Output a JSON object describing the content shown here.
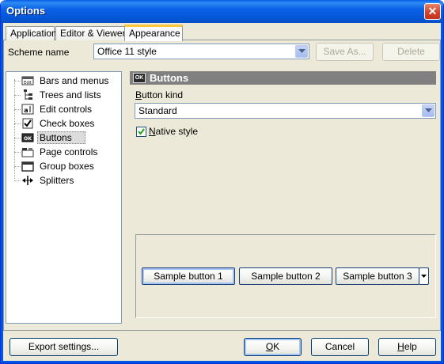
{
  "window": {
    "title": "Options"
  },
  "tabs": [
    {
      "label": "Application"
    },
    {
      "label": "Editor & Viewers"
    },
    {
      "label": "Appearance"
    }
  ],
  "scheme": {
    "label": "Scheme name",
    "value": "Office 11 style",
    "save_as": "Save As...",
    "delete": "Delete"
  },
  "tree": {
    "items": [
      {
        "label": "Bars and menus",
        "icon": "bars-menus-icon"
      },
      {
        "label": "Trees and lists",
        "icon": "tree-list-icon"
      },
      {
        "label": "Edit controls",
        "icon": "edit-control-icon"
      },
      {
        "label": "Check boxes",
        "icon": "checkbox-icon"
      },
      {
        "label": "Buttons",
        "icon": "button-icon"
      },
      {
        "label": "Page controls",
        "icon": "page-control-icon"
      },
      {
        "label": "Group boxes",
        "icon": "group-box-icon"
      },
      {
        "label": "Splitters",
        "icon": "splitter-icon"
      }
    ],
    "selected_index": 4
  },
  "panel": {
    "header": "Buttons",
    "header_icon_text": "OK",
    "button_kind_label": "Button kind",
    "button_kind_value": "Standard",
    "native_style_label": "Native style",
    "native_style_checked": true
  },
  "samples": [
    {
      "label": "Sample button 1"
    },
    {
      "label": "Sample button 2"
    },
    {
      "label": "Sample button 3"
    }
  ],
  "footer": {
    "export": "Export settings...",
    "ok": "OK",
    "cancel": "Cancel",
    "help": "Help"
  },
  "colors": {
    "titlebar": "#0055e5",
    "dialog_bg": "#ece9d8",
    "tab_highlight": "#ffc83c",
    "section_header": "#808080"
  }
}
